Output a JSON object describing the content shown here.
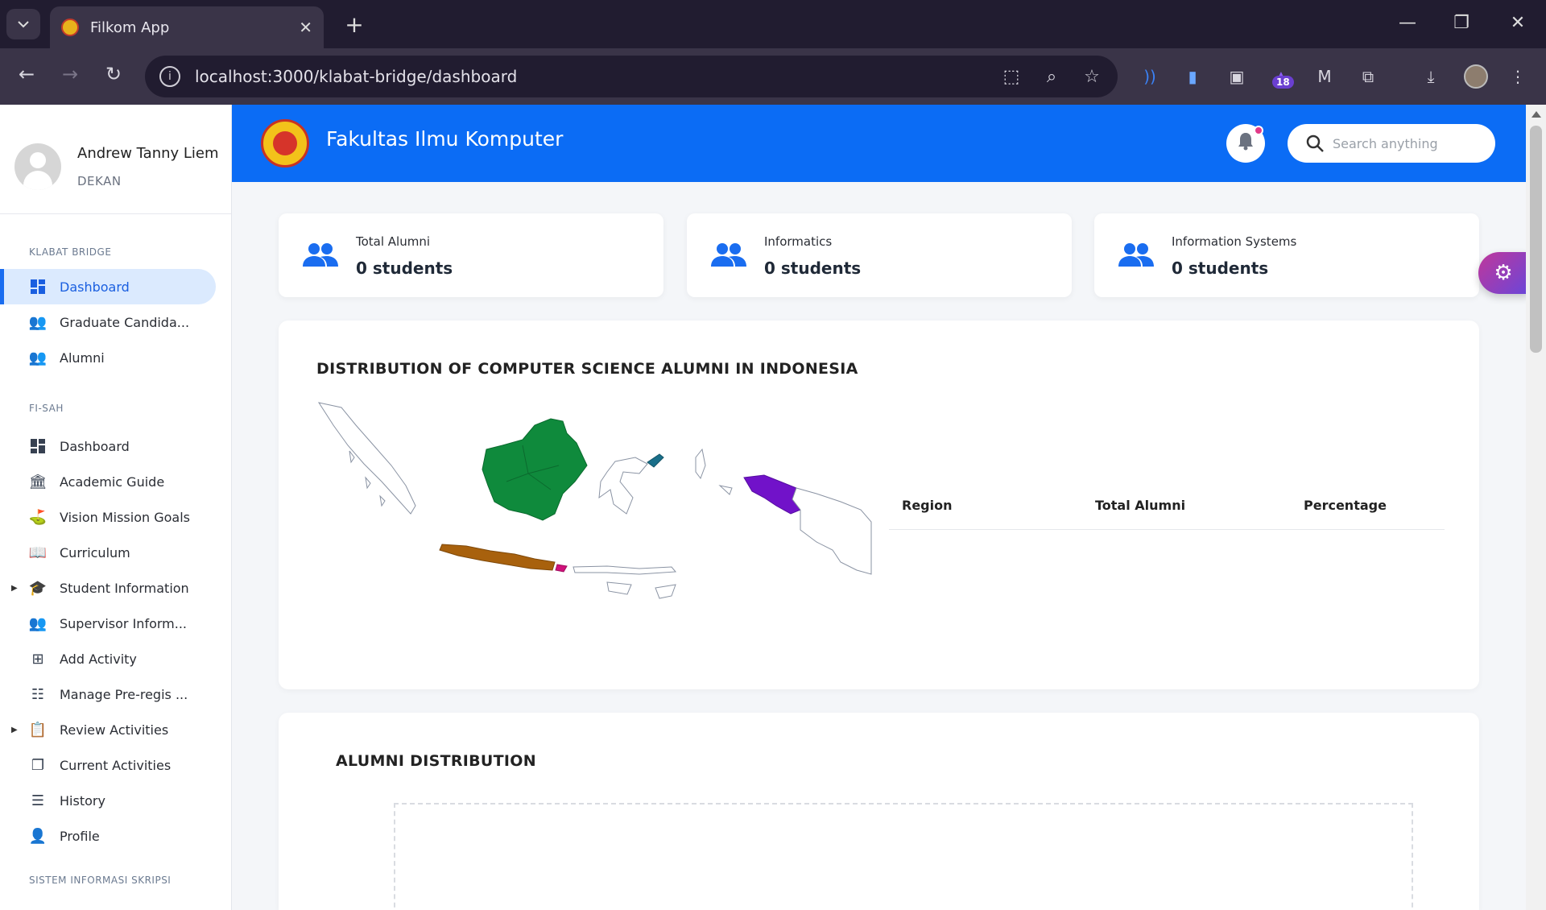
{
  "browser": {
    "tab_title": "Filkom App",
    "url": "localhost:3000/klabat-bridge/dashboard",
    "extension_badge": "18"
  },
  "user": {
    "name": "Andrew Tanny Liem",
    "role": "DEKAN"
  },
  "sidebar": {
    "sections": [
      {
        "label": "KLABAT BRIDGE",
        "items": [
          {
            "label": "Dashboard",
            "icon": "dashboard-icon",
            "active": true
          },
          {
            "label": "Graduate Candida...",
            "icon": "groups-icon"
          },
          {
            "label": "Alumni",
            "icon": "people-icon"
          }
        ]
      },
      {
        "label": "FI-SAH",
        "items": [
          {
            "label": "Dashboard",
            "icon": "dashboard-icon"
          },
          {
            "label": "Academic Guide",
            "icon": "institution-icon"
          },
          {
            "label": "Vision Mission Goals",
            "icon": "goal-icon"
          },
          {
            "label": "Curriculum",
            "icon": "book-icon"
          },
          {
            "label": "Student Information",
            "icon": "school-icon",
            "expandable": true
          },
          {
            "label": "Supervisor Inform...",
            "icon": "people-icon"
          },
          {
            "label": "Add Activity",
            "icon": "add-box-icon"
          },
          {
            "label": "Manage Pre-regis ...",
            "icon": "list-alt-icon"
          },
          {
            "label": "Review Activities",
            "icon": "clipboard-icon",
            "expandable": true
          },
          {
            "label": "Current Activities",
            "icon": "copy-icon"
          },
          {
            "label": "History",
            "icon": "history-icon"
          },
          {
            "label": "Profile",
            "icon": "profile-icon"
          }
        ]
      },
      {
        "label": "SISTEM INFORMASI SKRIPSI",
        "items": []
      }
    ]
  },
  "header": {
    "brand": "Fakultas Ilmu Komputer",
    "search_placeholder": "Search anything"
  },
  "stats": [
    {
      "label": "Total Alumni",
      "value": "0 students"
    },
    {
      "label": "Informatics",
      "value": "0 students"
    },
    {
      "label": "Information Systems",
      "value": "0 students"
    }
  ],
  "map_panel": {
    "title": "DISTRIBUTION OF COMPUTER SCIENCE ALUMNI IN INDONESIA",
    "table_headers": [
      "Region",
      "Total Alumni",
      "Percentage"
    ],
    "colors": {
      "kalimantan": "#0f8a3c",
      "java": "#a8610d",
      "papua": "#7112c9",
      "sulawesi_north": "#1a6f8a",
      "bali": "#d0117b"
    }
  },
  "distribution_panel": {
    "title": "ALUMNI DISTRIBUTION"
  },
  "colors": {
    "primary": "#0b6cf5",
    "active_bg": "#dbeafe"
  }
}
